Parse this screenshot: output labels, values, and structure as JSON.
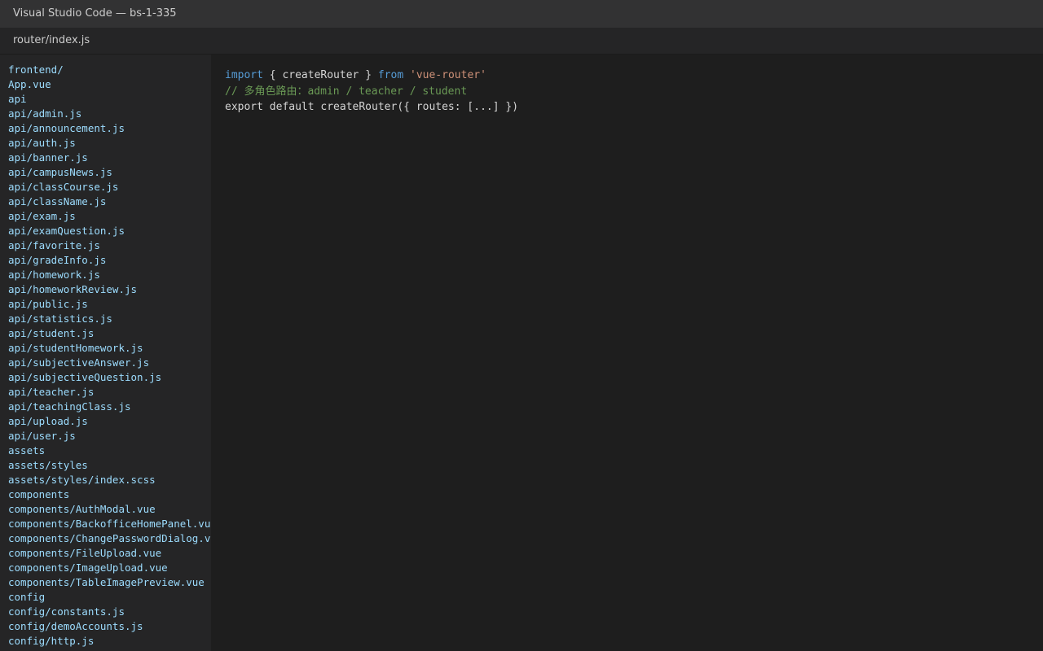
{
  "window": {
    "title": "Visual Studio Code — bs-1-335"
  },
  "tab": {
    "label": "router/index.js"
  },
  "sidebar": {
    "items": [
      "frontend/",
      "App.vue",
      "api",
      "api/admin.js",
      "api/announcement.js",
      "api/auth.js",
      "api/banner.js",
      "api/campusNews.js",
      "api/classCourse.js",
      "api/className.js",
      "api/exam.js",
      "api/examQuestion.js",
      "api/favorite.js",
      "api/gradeInfo.js",
      "api/homework.js",
      "api/homeworkReview.js",
      "api/public.js",
      "api/statistics.js",
      "api/student.js",
      "api/studentHomework.js",
      "api/subjectiveAnswer.js",
      "api/subjectiveQuestion.js",
      "api/teacher.js",
      "api/teachingClass.js",
      "api/upload.js",
      "api/user.js",
      "assets",
      "assets/styles",
      "assets/styles/index.scss",
      "components",
      "components/AuthModal.vue",
      "components/BackofficeHomePanel.vue",
      "components/ChangePasswordDialog.vue",
      "components/FileUpload.vue",
      "components/ImageUpload.vue",
      "components/TableImagePreview.vue",
      "config",
      "config/constants.js",
      "config/demoAccounts.js",
      "config/http.js"
    ]
  },
  "editor": {
    "line1": {
      "kw_import": "import",
      "braces": " { createRouter } ",
      "kw_from": "from",
      "space": " ",
      "module": "'vue-router'"
    },
    "line2": {
      "comment": "// 多角色路由：admin / teacher / student"
    },
    "line3": {
      "code": "export default createRouter({ routes: [...] })"
    }
  },
  "colors": {
    "keyword": "#569cd6",
    "string": "#ce9178",
    "comment": "#6a9955",
    "sidebar_text": "#9cdcfe"
  }
}
